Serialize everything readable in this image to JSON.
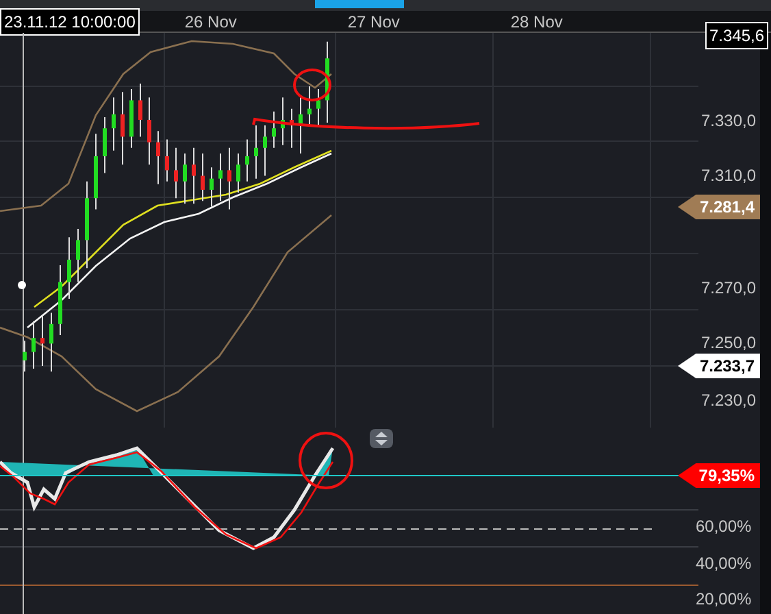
{
  "header": {
    "cursor_time": "23.11.12 10:00:00",
    "dates": [
      "26 Nov",
      "27 Nov",
      "28 Nov"
    ]
  },
  "price_axis": {
    "current": "7.345,6",
    "ticks": [
      "7.330,0",
      "7.310,0",
      "7.270,0",
      "7.250,0",
      "7.230,0"
    ],
    "markers": [
      {
        "label": "7.281,4",
        "color": "#a07c55"
      },
      {
        "label": "7.233,7",
        "color": "#ffffff"
      }
    ]
  },
  "oscillator_axis": {
    "marker": {
      "label": "79,35%",
      "color": "#ff0000"
    },
    "ticks": [
      "60,00%",
      "40,00%",
      "20,00%"
    ]
  }
}
